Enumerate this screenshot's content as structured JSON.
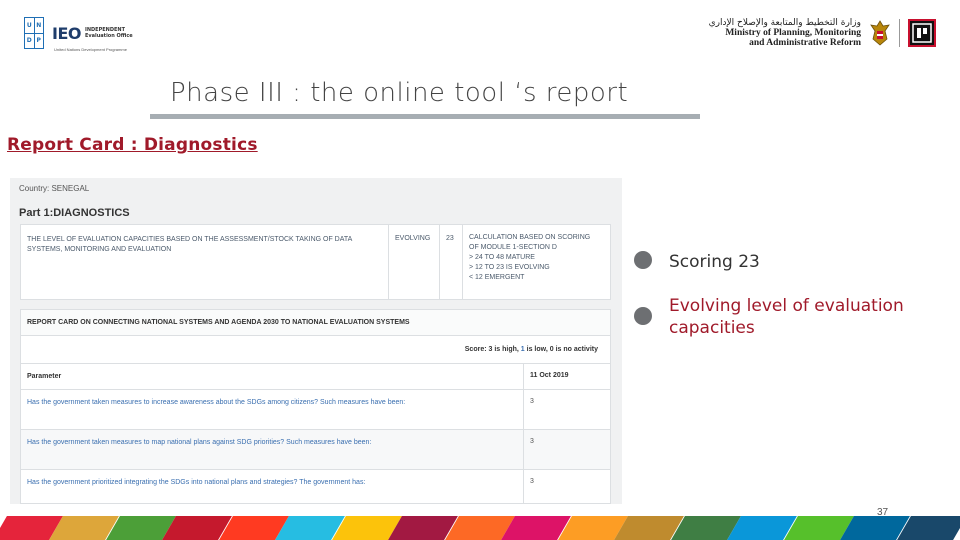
{
  "header": {
    "undp_letters": [
      "U",
      "N",
      "D",
      "P"
    ],
    "ieo_mark": "IEO",
    "ieo_line1": "INDEPENDENT",
    "ieo_line2": "Evaluation Office",
    "ieo_sub": "United Nations Development Programme",
    "ministry_ar": "وزارة التخطيط والمتابعة والإصلاح الإداري",
    "ministry_en1": "Ministry of Planning, Monitoring",
    "ministry_en2": "and Administrative Reform",
    "badge_icon": "egypt-vision-badge-icon",
    "eagle_icon": "eagle-emblem-icon"
  },
  "slide": {
    "title": "Phase III : the online tool ‘s report",
    "subtitle": "Report Card : Diagnostics",
    "page_number": "37"
  },
  "screenshot": {
    "country": "Country: SENEGAL",
    "part_title": "Part 1:DIAGNOSTICS",
    "diagnostics_row": {
      "description": "THE LEVEL OF EVALUATION CAPACITIES BASED ON THE ASSESSMENT/STOCK TAKING OF DATA SYSTEMS, MONITORING AND EVALUATION",
      "level": "EVOLVING",
      "score": "23",
      "calc_lines": [
        "CALCULATION BASED ON SCORING",
        "OF MODULE 1-SECTION D",
        "> 24 TO 48 MATURE",
        "> 12 TO 23 IS EVOLVING",
        "< 12 EMERGENT"
      ]
    },
    "report_card": {
      "heading": "REPORT CARD ON CONNECTING NATIONAL SYSTEMS AND AGENDA 2030 TO NATIONAL EVALUATION SYSTEMS",
      "score_legend_prefix": "Score: ",
      "score_3": "3",
      "score_legend_mid1": " is high, ",
      "score_1": "1",
      "score_legend_mid2": " is low, ",
      "score_0": "0",
      "score_legend_end": " is no activity",
      "col_parameter": "Parameter",
      "col_date": "11 Oct 2019",
      "rows": [
        {
          "parameter": "Has the government taken measures to increase awareness about the SDGs among citizens? Such measures have been:",
          "value": "3"
        },
        {
          "parameter": "Has the government taken measures to map national plans against SDG priorities? Such measures have been:",
          "value": "3"
        },
        {
          "parameter": "Has the government prioritized integrating the SDGs into national plans and strategies? The government has:",
          "value": "3"
        }
      ]
    }
  },
  "bullets": [
    {
      "text": "Scoring 23",
      "color": "#333333"
    },
    {
      "text_line1": "Evolving level of evaluation",
      "text_line2": "capacities",
      "color": "#a01a2a"
    }
  ],
  "colors": {
    "accent_red": "#a01a2a",
    "title_bar": "#a7aeb3",
    "bullet_grey": "#6d6f72",
    "stripe": [
      "#e5243b",
      "#dda63a",
      "#4c9f38",
      "#c5192d",
      "#ff3a21",
      "#26bde2",
      "#fcc30b",
      "#a21942",
      "#fd6925",
      "#dd1367",
      "#fd9d24",
      "#bf8b2e",
      "#3f7e44",
      "#0a97d9",
      "#56c02b",
      "#00689d",
      "#19486a"
    ]
  }
}
